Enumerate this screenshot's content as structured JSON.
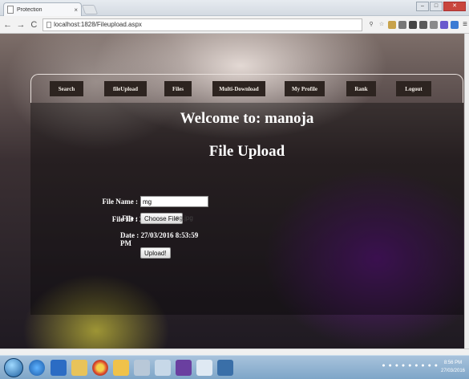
{
  "browser": {
    "tab_title": "Protection",
    "tab_close": "×",
    "url": "localhost:1828/Fileupload.aspx",
    "win_minimize": "–",
    "win_maximize": "□",
    "win_close": "✕"
  },
  "nav": {
    "items": [
      "Search",
      "fileUpload",
      "Files",
      "Multi-Download",
      "My Profile",
      "Rank",
      "Logout"
    ]
  },
  "content": {
    "welcome": "Welcome to: manoja",
    "heading": "File Upload",
    "file_id_label": "File ID : 28",
    "file_name_label": "File Name :",
    "file_name_value": "mg",
    "file_label": "File :",
    "choose_button": "Choose File",
    "file_status": "ng.jpg",
    "date_label": "Date : 27/03/2016 8:53:59 PM",
    "upload_button": "Upload!"
  },
  "taskbar": {
    "time": "8:56 PM",
    "date": "27/03/2016"
  },
  "colors": {
    "nav_button_bg": "#2d2420",
    "overlay": "#000000",
    "accent_purple": "#5a1a7a"
  }
}
